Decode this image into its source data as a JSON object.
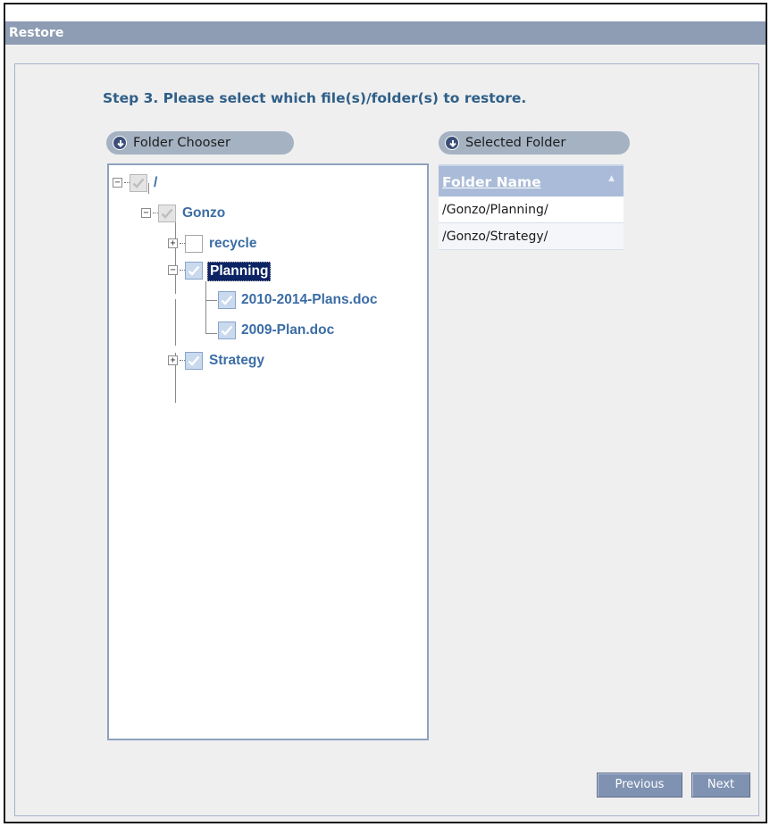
{
  "window": {
    "title": "Restore"
  },
  "step_title": "Step 3. Please select which file(s)/folder(s) to restore.",
  "folder_chooser": {
    "title": "Folder Chooser",
    "tree": [
      {
        "label": "/",
        "checked": "partial",
        "expander": "minus",
        "selected": false
      },
      {
        "label": "Gonzo",
        "checked": "partial",
        "expander": "minus",
        "selected": false
      },
      {
        "label": "recycle",
        "checked": "unchecked",
        "expander": "plus",
        "selected": false
      },
      {
        "label": "Planning",
        "checked": "checked",
        "expander": "minus",
        "selected": true
      },
      {
        "label": "2010-2014-Plans.doc",
        "checked": "checked",
        "expander": "none",
        "selected": false
      },
      {
        "label": "2009-Plan.doc",
        "checked": "checked",
        "expander": "none",
        "selected": false
      },
      {
        "label": "Strategy",
        "checked": "checked",
        "expander": "plus",
        "selected": false
      }
    ]
  },
  "selected_folder": {
    "title": "Selected Folder",
    "column_header": "Folder Name",
    "rows": [
      "/Gonzo/Planning/",
      "/Gonzo/Strategy/"
    ]
  },
  "buttons": {
    "previous": "Previous",
    "next": "Next"
  },
  "icons": {
    "pill_icon": "circle-down-arrow-icon",
    "expand": "plus-icon",
    "collapse": "minus-icon",
    "check": "checkmark-icon",
    "sort": "sort-ascending-icon"
  },
  "colors": {
    "titlebar": "#8e9cb4",
    "accent_text": "#2f5f88",
    "tree_link": "#3b6da5",
    "selection": "#0c2364",
    "button": "#7f92b2"
  }
}
